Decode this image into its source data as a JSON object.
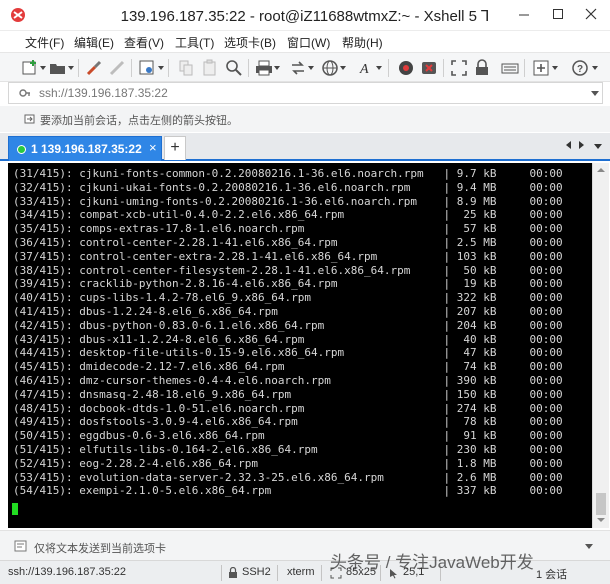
{
  "window": {
    "title": "139.196.187.35:22 - root@iZ11688wtmxZ:~ - Xshell 5",
    "title_glyph": "⅂"
  },
  "menu": {
    "items": [
      "文件(F)",
      "编辑(E)",
      "查看(V)",
      "工具(T)",
      "选项卡(B)",
      "窗口(W)",
      "帮助(H)"
    ]
  },
  "toolbar": {
    "icons": [
      "new-session",
      "open",
      "reconnect",
      "disconnect",
      "properties",
      "copy",
      "paste",
      "find",
      "print",
      "transfer",
      "globe",
      "font",
      "xftp",
      "xmanager",
      "fullscreen",
      "lock",
      "keyboard",
      "compose",
      "help"
    ]
  },
  "address": {
    "value": "ssh://139.196.187.35:22"
  },
  "infobar": {
    "text": "要添加当前会话，点击左侧的箭头按钮。"
  },
  "tabs": {
    "active_label": "1 139.196.187.35:22",
    "close": "×",
    "add": "+"
  },
  "terminal": {
    "lines": [
      "(31/415): cjkuni-fonts-common-0.2.20080216.1-36.el6.noarch.rpm   | 9.7 kB     00:00",
      "(32/415): cjkuni-ukai-fonts-0.2.20080216.1-36.el6.noarch.rpm     | 9.4 MB     00:00",
      "(33/415): cjkuni-uming-fonts-0.2.20080216.1-36.el6.noarch.rpm    | 8.9 MB     00:00",
      "(34/415): compat-xcb-util-0.4.0-2.2.el6.x86_64.rpm               |  25 kB     00:00",
      "(35/415): comps-extras-17.8-1.el6.noarch.rpm                     |  57 kB     00:00",
      "(36/415): control-center-2.28.1-41.el6.x86_64.rpm                | 2.5 MB     00:00",
      "(37/415): control-center-extra-2.28.1-41.el6.x86_64.rpm          | 103 kB     00:00",
      "(38/415): control-center-filesystem-2.28.1-41.el6.x86_64.rpm     |  50 kB     00:00",
      "(39/415): cracklib-python-2.8.16-4.el6.x86_64.rpm                |  19 kB     00:00",
      "(40/415): cups-libs-1.4.2-78.el6_9.x86_64.rpm                    | 322 kB     00:00",
      "(41/415): dbus-1.2.24-8.el6_6.x86_64.rpm                         | 207 kB     00:00",
      "(42/415): dbus-python-0.83.0-6.1.el6.x86_64.rpm                  | 204 kB     00:00",
      "(43/415): dbus-x11-1.2.24-8.el6_6.x86_64.rpm                     |  40 kB     00:00",
      "(44/415): desktop-file-utils-0.15-9.el6.x86_64.rpm               |  47 kB     00:00",
      "(45/415): dmidecode-2.12-7.el6.x86_64.rpm                        |  74 kB     00:00",
      "(46/415): dmz-cursor-themes-0.4-4.el6.noarch.rpm                 | 390 kB     00:00",
      "(47/415): dnsmasq-2.48-18.el6_9.x86_64.rpm                       | 150 kB     00:00",
      "(48/415): docbook-dtds-1.0-51.el6.noarch.rpm                     | 274 kB     00:00",
      "(49/415): dosfstools-3.0.9-4.el6.x86_64.rpm                      |  78 kB     00:00",
      "(50/415): eggdbus-0.6-3.el6.x86_64.rpm                           |  91 kB     00:00",
      "(51/415): elfutils-libs-0.164-2.el6.x86_64.rpm                   | 230 kB     00:00",
      "(52/415): eog-2.28.2-4.el6.x86_64.rpm                            | 1.8 MB     00:00",
      "(53/415): evolution-data-server-2.32.3-25.el6.x86_64.rpm         | 2.6 MB     00:00",
      "(54/415): exempi-2.1.0-5.el6.x86_64.rpm                          | 337 kB     00:00"
    ]
  },
  "compose": {
    "placeholder": "仅将文本发送到当前选项卡"
  },
  "status": {
    "address": "ssh://139.196.187.35:22",
    "protocol": "SSH2",
    "terminal": "xterm",
    "size": "85x25",
    "position": "25,1",
    "sessions": "1 会话"
  },
  "watermark": {
    "text": "头条号 / 专注JavaWeb开发"
  },
  "colors": {
    "tab_active": "#2f86e6",
    "terminal_bg": "#000000",
    "terminal_fg": "#d6d6d6",
    "cursor": "#22dd22"
  }
}
